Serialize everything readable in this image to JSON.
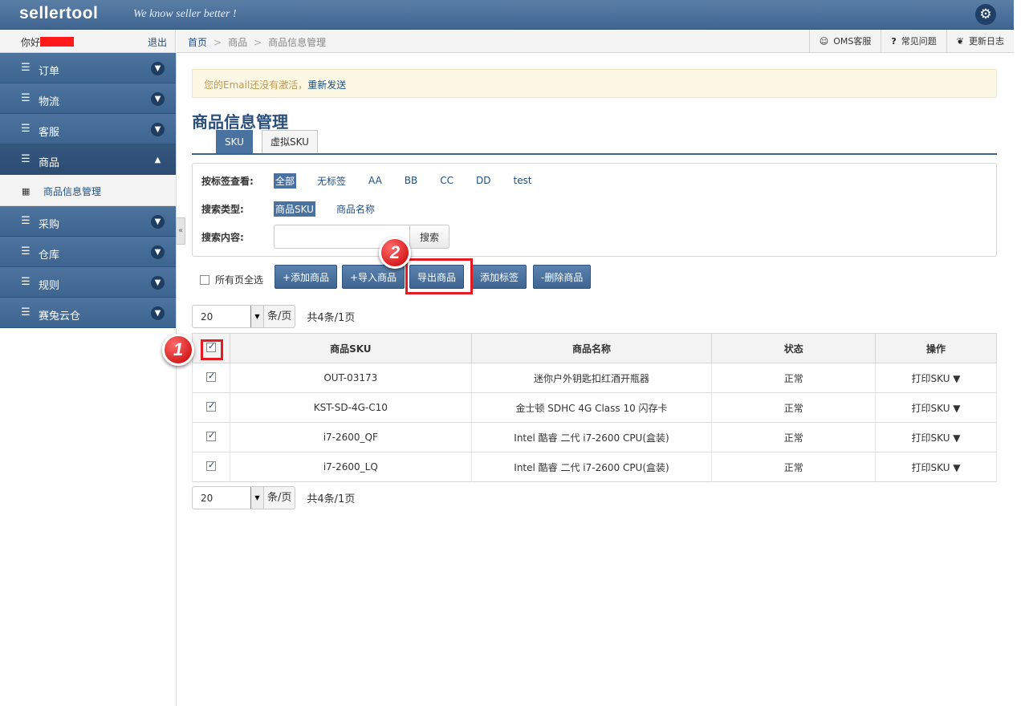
{
  "header": {
    "logo": "sellertool",
    "tagline": "We know seller better !"
  },
  "user": {
    "greeting": "你好",
    "logout": "退出"
  },
  "breadcrumb": {
    "home": "首页",
    "level1": "商品",
    "current": "商品信息管理",
    "sep": ">"
  },
  "toplinks": [
    {
      "icon": "user-icon",
      "glyph": "☺",
      "label": "OMS客服"
    },
    {
      "icon": "question-icon",
      "glyph": "?",
      "label": "常见问题"
    },
    {
      "icon": "leaf-icon",
      "glyph": "❦",
      "label": "更新日志"
    }
  ],
  "sidebar": {
    "items": [
      {
        "label": "订单"
      },
      {
        "label": "物流"
      },
      {
        "label": "客服"
      },
      {
        "label": "商品"
      },
      {
        "label": "采购"
      },
      {
        "label": "仓库"
      },
      {
        "label": "规则"
      },
      {
        "label": "赛兔云仓"
      }
    ],
    "sub_label": "商品信息管理"
  },
  "alert": {
    "text": "您的Email还没有激活，",
    "link": "重新发送"
  },
  "page": {
    "title": "商品信息管理"
  },
  "tabs": [
    {
      "label": "SKU"
    },
    {
      "label": "虚拟SKU"
    }
  ],
  "filter": {
    "tag_label": "按标签查看:",
    "tags": [
      "全部",
      "无标签",
      "AA",
      "BB",
      "CC",
      "DD",
      "test"
    ],
    "type_label": "搜索类型:",
    "types": [
      "商品SKU",
      "商品名称"
    ],
    "content_label": "搜索内容:",
    "search_value": "",
    "search_button": "搜索"
  },
  "actions": {
    "all_pages": "所有页全选",
    "add": "+添加商品",
    "import": "+导入商品",
    "export": "导出商品",
    "tag": "添加标签",
    "delete": "-删除商品"
  },
  "pager": {
    "size": "20",
    "unit": "条/页",
    "total": "共4条/1页"
  },
  "annotations": {
    "step1": "1",
    "step2": "2"
  },
  "table": {
    "headers": [
      "商品SKU",
      "商品名称",
      "状态",
      "操作"
    ],
    "rows": [
      {
        "sku": "OUT-03173",
        "name": "迷你户外钥匙扣红酒开瓶器",
        "status": "正常",
        "op": "打印SKU ▼"
      },
      {
        "sku": "KST-SD-4G-C10",
        "name": "金士顿 SDHC 4G Class 10 闪存卡",
        "status": "正常",
        "op": "打印SKU ▼"
      },
      {
        "sku": "i7-2600_QF",
        "name": "Intel 酷睿 二代 i7-2600 CPU(盒装)",
        "status": "正常",
        "op": "打印SKU ▼"
      },
      {
        "sku": "i7-2600_LQ",
        "name": "Intel 酷睿 二代 i7-2600 CPU(盒装)",
        "status": "正常",
        "op": "打印SKU ▼"
      }
    ]
  },
  "colors": {
    "brand": "#3f6591",
    "highlight": "#e51b24",
    "status_ok": "#2aa12a"
  }
}
